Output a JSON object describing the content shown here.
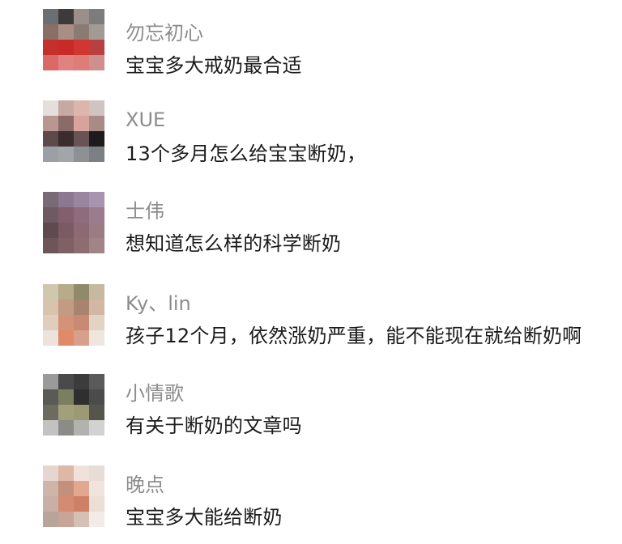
{
  "comments": [
    {
      "name": "勿忘初心",
      "text": "宝宝多大戒奶最合适",
      "avatar_palette": [
        "#6b6f72",
        "#3f3a3a",
        "#9a8f8a",
        "#7c7c7c",
        "#8a6f66",
        "#a88f86",
        "#8b7b72",
        "#a39a94",
        "#c5302c",
        "#c82a28",
        "#d13632",
        "#b84040",
        "#d96a66",
        "#e08380",
        "#de7c78",
        "#cf8f8c"
      ]
    },
    {
      "name": "XUE",
      "text": "13个多月怎么给宝宝断奶，",
      "avatar_palette": [
        "#e6dedb",
        "#c7a9a4",
        "#dcb6ad",
        "#cfc4c1",
        "#b99790",
        "#8b6a68",
        "#d7a39c",
        "#a98a86",
        "#5d4a4b",
        "#3b2c2e",
        "#6a5354",
        "#1f1a1c",
        "#9aa0a6",
        "#a3a6a9",
        "#8d9196",
        "#7c8086"
      ]
    },
    {
      "name": "士伟",
      "text": "想知道怎么样的科学断奶",
      "avatar_palette": [
        "#7a6a76",
        "#8d7891",
        "#9b86a0",
        "#a894ae",
        "#6f5a63",
        "#835f6e",
        "#8f6c7d",
        "#9b7c8c",
        "#5e4a4f",
        "#7a5a63",
        "#8c6a74",
        "#9b7c84",
        "#6d5558",
        "#7f6065",
        "#8d6d70",
        "#a08488"
      ]
    },
    {
      "name": "Ky、lin",
      "text": "孩子12个月，依然涨奶严重，能不能现在就给断奶啊",
      "avatar_palette": [
        "#cfc7ae",
        "#b7ab8a",
        "#8f8a6a",
        "#c7b9a0",
        "#d8c3ac",
        "#c19c82",
        "#a8846e",
        "#d1b7a4",
        "#e0cdbd",
        "#d49276",
        "#c98a74",
        "#e3d3c5",
        "#ece3da",
        "#e08a6a",
        "#d7a08a",
        "#efe7de"
      ]
    },
    {
      "name": "小情歌",
      "text": "有关于断奶的文章吗",
      "avatar_palette": [
        "#9a9a9a",
        "#4a4a4a",
        "#3c3c3c",
        "#5a5a5a",
        "#5b5b55",
        "#7a7f62",
        "#2f2f2f",
        "#4b4b4b",
        "#6b6b5f",
        "#a2a07a",
        "#9b9a74",
        "#55554d",
        "#c2c2c2",
        "#8b8b88",
        "#b2b2ae",
        "#d2d2d2"
      ]
    },
    {
      "name": "晚点",
      "text": "宝宝多大能给断奶",
      "avatar_palette": [
        "#e6d6cf",
        "#ddb8a6",
        "#f0e2da",
        "#e8ddd6",
        "#cfb4a8",
        "#c48f7c",
        "#e2a78f",
        "#efe4de",
        "#c9b0a6",
        "#d48a73",
        "#cf7f66",
        "#eaded6",
        "#b8a49a",
        "#c9a498",
        "#d6bfb3",
        "#f2ebe6"
      ]
    }
  ]
}
